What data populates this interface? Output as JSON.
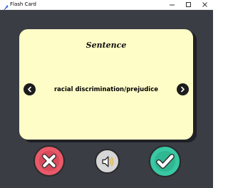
{
  "window": {
    "title": "Flash Card",
    "icons": {
      "app": "feather-icon",
      "minimize": "minimize-icon",
      "maximize": "maximize-icon",
      "close": "close-icon"
    }
  },
  "card": {
    "title": "Sentence",
    "text": "racial discrimination/prejudice"
  },
  "controls": {
    "prev_icon": "chevron-left-icon",
    "next_icon": "chevron-right-icon",
    "wrong_icon": "x-icon",
    "sound_icon": "speaker-icon",
    "right_icon": "check-icon"
  },
  "colors": {
    "background": "#3a3d44",
    "card": "#fffdc7",
    "wrong": "#e85a6a",
    "sound": "#d6d6d6",
    "right": "#38c8a4"
  }
}
